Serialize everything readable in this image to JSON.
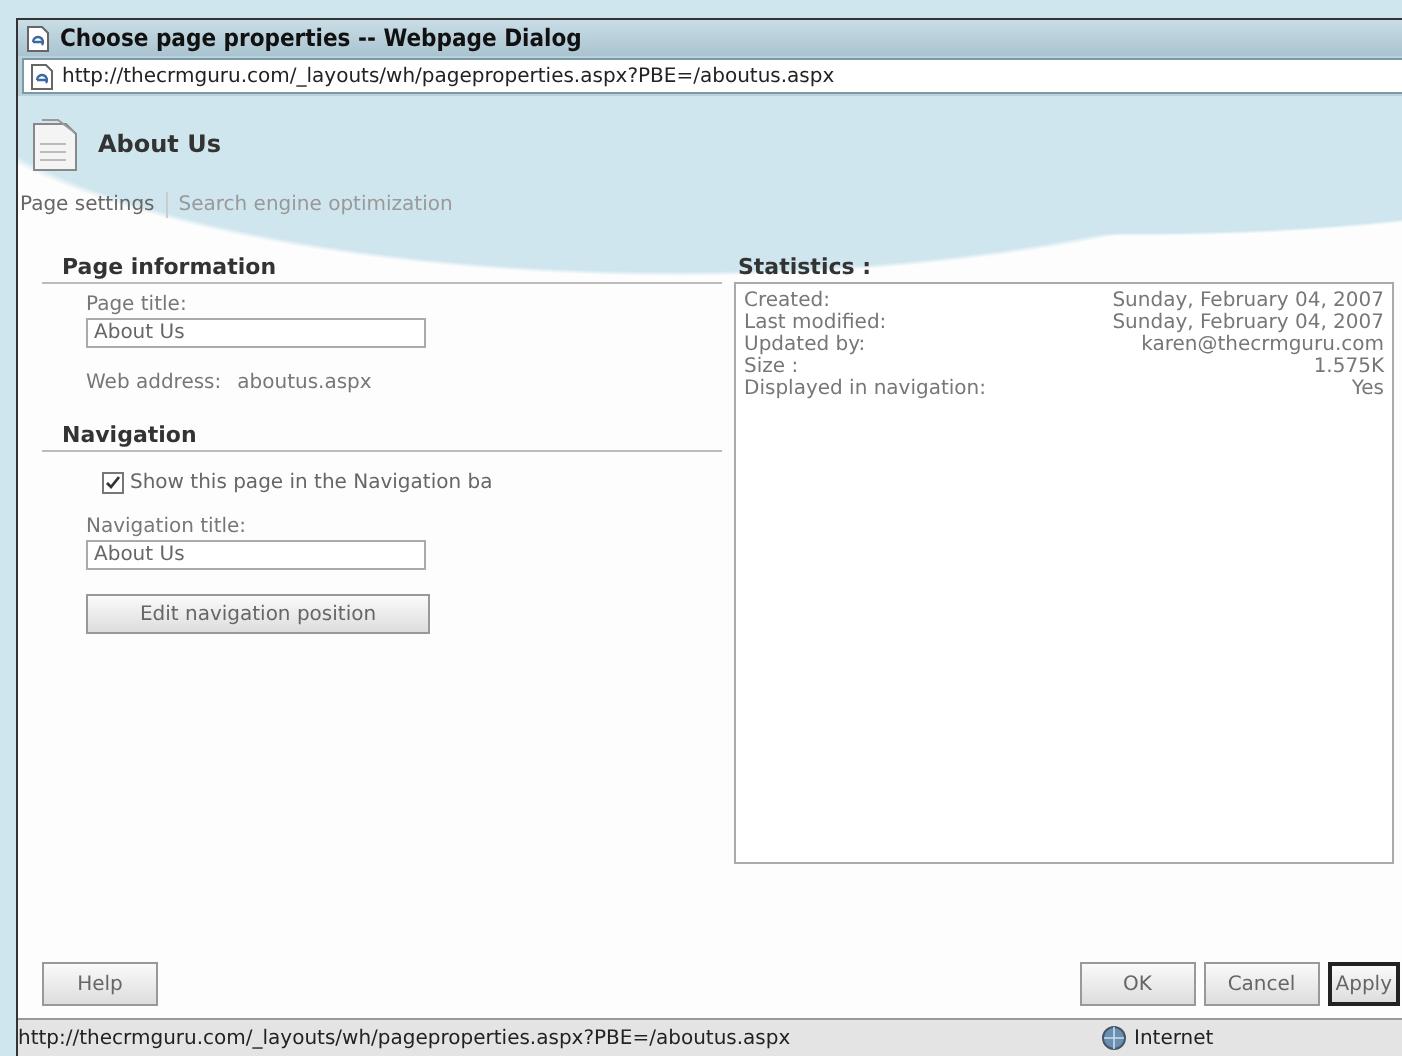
{
  "window": {
    "title": "Choose page properties -- Webpage Dialog"
  },
  "address_bar": {
    "url": "http://thecrmguru.com/_layouts/wh/pageproperties.aspx?PBE=/aboutus.aspx"
  },
  "page_header": {
    "title": "About Us"
  },
  "tabs": [
    {
      "label": "Page settings",
      "selected": true
    },
    {
      "label": "Search engine optimization",
      "selected": false
    }
  ],
  "page_information": {
    "heading": "Page information",
    "page_title_label": "Page title:",
    "page_title_value": "About Us",
    "web_address_label": "Web address:",
    "web_address_value": "aboutus.aspx"
  },
  "navigation": {
    "heading": "Navigation",
    "show_in_navigation": {
      "label": "Show this page in the Navigation ba",
      "checked": true
    },
    "navigation_title_label": "Navigation title:",
    "navigation_title_value": "About Us",
    "edit_button": "Edit navigation position"
  },
  "statistics": {
    "heading": "Statistics :",
    "rows": [
      {
        "label": "Created:",
        "value": "Sunday, February 04, 2007"
      },
      {
        "label": "Last modified:",
        "value": "Sunday, February 04, 2007"
      },
      {
        "label": "Updated by:",
        "value": "karen@thecrmguru.com"
      },
      {
        "label": "Size :",
        "value": "1.575K"
      },
      {
        "label": "Displayed in navigation:",
        "value": "Yes"
      }
    ]
  },
  "buttons": [
    {
      "label": "Help",
      "default": false
    },
    {
      "label": "OK",
      "default": false
    },
    {
      "label": "Cancel",
      "default": false
    },
    {
      "label": "Apply",
      "default": true
    }
  ],
  "status_bar": {
    "url": "http://thecrmguru.com/_layouts/wh/pageproperties.aspx?PBE=/aboutus.aspx",
    "zone": "Internet"
  }
}
